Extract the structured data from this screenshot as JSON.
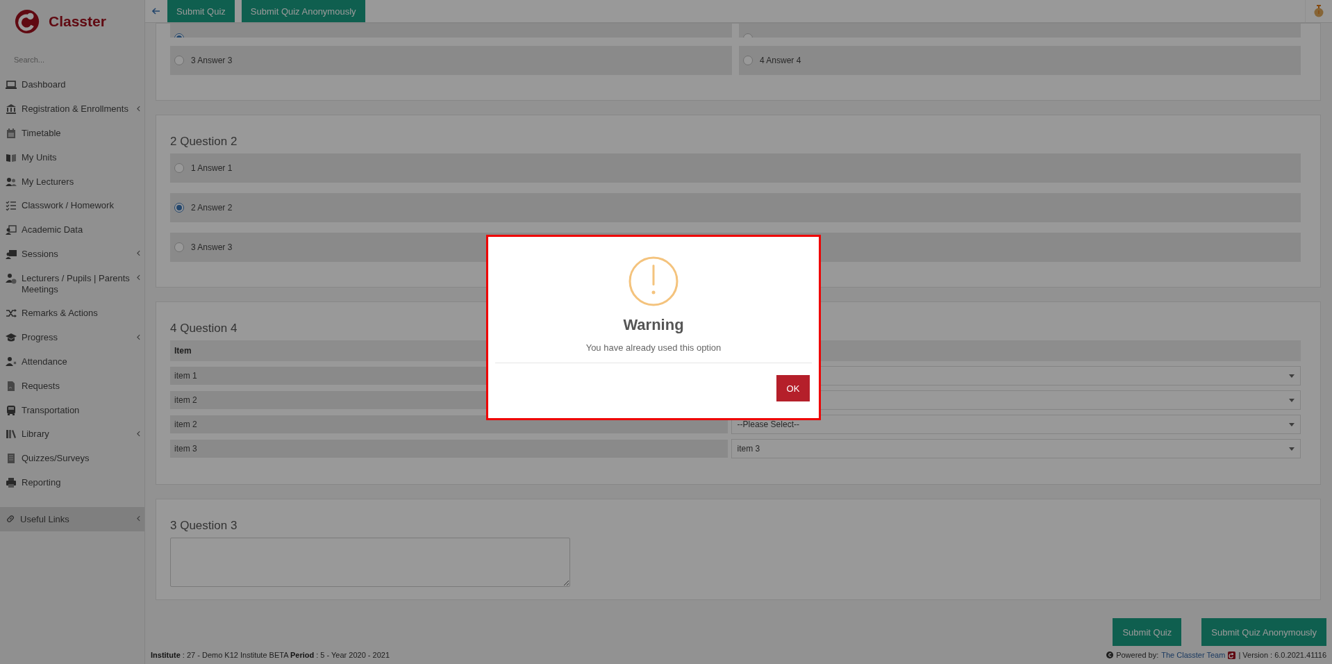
{
  "sidebar": {
    "brand": "Classter",
    "search": {
      "placeholder": "Search..."
    },
    "items": [
      {
        "label": "Dashboard",
        "has_submenu": false
      },
      {
        "label": "Registration & Enrollments",
        "has_submenu": true
      },
      {
        "label": "Timetable",
        "has_submenu": false
      },
      {
        "label": "My Units",
        "has_submenu": false
      },
      {
        "label": "My Lecturers",
        "has_submenu": false
      },
      {
        "label": "Classwork / Homework",
        "has_submenu": false
      },
      {
        "label": "Academic Data",
        "has_submenu": false
      },
      {
        "label": "Sessions",
        "has_submenu": true
      },
      {
        "label": "Lecturers / Pupils | Parents Meetings",
        "has_submenu": true
      },
      {
        "label": "Remarks & Actions",
        "has_submenu": false
      },
      {
        "label": "Progress",
        "has_submenu": true
      },
      {
        "label": "Attendance",
        "has_submenu": false
      },
      {
        "label": "Requests",
        "has_submenu": false
      },
      {
        "label": "Transportation",
        "has_submenu": false
      },
      {
        "label": "Library",
        "has_submenu": true
      },
      {
        "label": "Quizzes/Surveys",
        "has_submenu": false
      },
      {
        "label": "Reporting",
        "has_submenu": false
      }
    ],
    "footer_item": {
      "label": "Useful Links",
      "has_submenu": true,
      "selected": true
    }
  },
  "toolbar": {
    "buttons": [
      "Submit Quiz",
      "Submit Quiz Anonymously"
    ]
  },
  "questions": [
    {
      "kind": "grid",
      "answers": [
        {
          "selected": true
        },
        {
          "selected": false
        },
        {
          "label": "3 Answer 3",
          "selected": false
        },
        {
          "label": "4 Answer 4",
          "selected": false
        }
      ]
    },
    {
      "kind": "choice",
      "title": "2 Question 2",
      "answers": [
        {
          "label": "1 Answer 1",
          "selected": false
        },
        {
          "label": "2 Answer 2",
          "selected": true
        },
        {
          "label": "3 Answer 3",
          "selected": false
        }
      ]
    },
    {
      "kind": "matching",
      "title": "4 Question 4",
      "header": "Item",
      "rows": [
        {
          "item": "item 1"
        },
        {
          "item": "item 2"
        },
        {
          "item": "item 2",
          "value": "--Please Select--"
        },
        {
          "item": "item 3",
          "value": "item 3"
        }
      ]
    },
    {
      "kind": "text",
      "title": "3 Question 3"
    }
  ],
  "actions": [
    "Submit Quiz",
    "Submit Quiz Anonymously"
  ],
  "status_bar": {
    "left": "**Institute** : 27 - Demo K12 Institute BETA **Period** : 5 - Year 2020 - 2021",
    "powered_label": "Powered by:",
    "powered_link": "The Classter Team",
    "version": "| Version : 6.0.2021.41116"
  },
  "dialog": {
    "title": "Warning",
    "message": "You have already used this option",
    "button": "OK"
  }
}
